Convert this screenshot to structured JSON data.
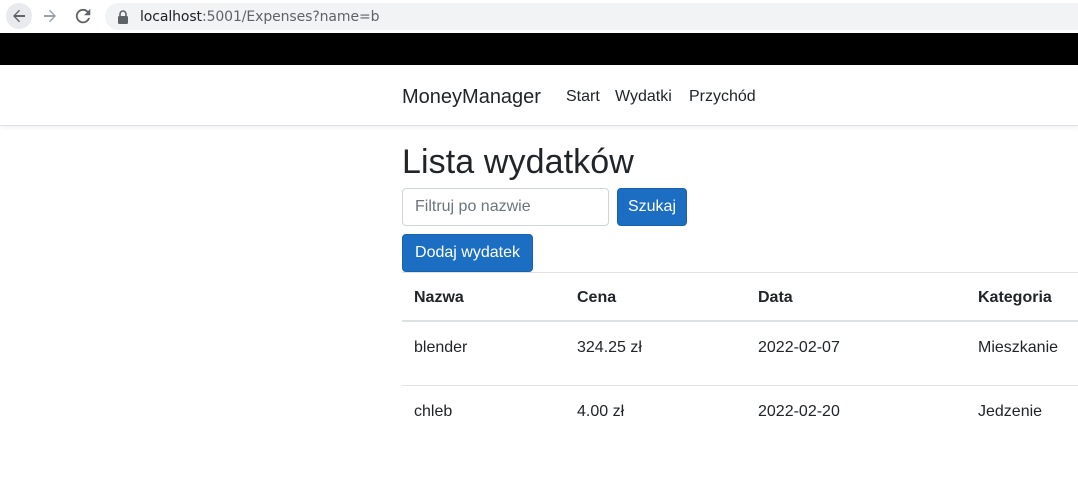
{
  "browser": {
    "url_host": "localhost",
    "url_path": ":5001/Expenses?name=b"
  },
  "navbar": {
    "brand": "MoneyManager",
    "links": [
      "Start",
      "Wydatki",
      "Przychód"
    ]
  },
  "main": {
    "title": "Lista wydatków",
    "search_placeholder": "Filtruj po nazwie",
    "search_value": "",
    "search_button": "Szukaj",
    "add_button": "Dodaj wydatek"
  },
  "table": {
    "headers": [
      "Nazwa",
      "Cena",
      "Data",
      "Kategoria"
    ],
    "rows": [
      [
        "blender",
        "324.25 zł",
        "2022-02-07",
        "Mieszkanie"
      ],
      [
        "chleb",
        "4.00 zł",
        "2022-02-20",
        "Jedzenie"
      ]
    ]
  },
  "colors": {
    "primary": "#1b6ec2",
    "border": "#dee2e6"
  }
}
